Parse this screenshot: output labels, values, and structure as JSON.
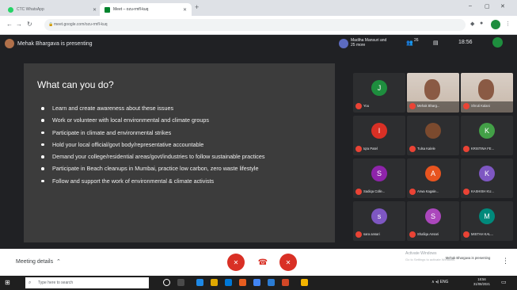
{
  "browser": {
    "tabs": [
      {
        "title": "CTC WhatsApp"
      },
      {
        "title": "Meet – ozu-rmfl-kuq"
      }
    ],
    "new_tab": "+",
    "win_min": "–",
    "win_max": "▢",
    "win_close": "✕",
    "url": "meet.google.com/ozu-rmfl-kuq"
  },
  "meet": {
    "presenter_label": "Mehak Bhargava is presenting",
    "slide": {
      "title": "What can you do?",
      "bullets": [
        "Learn and create awareness about these issues",
        "Work or volunteer with local environmental and climate groups",
        "Participate in climate and environmental strikes",
        "Hold your local official/govt body/representative accountable",
        "Demand your college/residential areas/govt/industries to follow sustainable practices",
        "Participate in Beach cleanups in Mumbai, practice low carbon, zero waste lifestyle",
        "Follow and support the work of environmental & climate activists"
      ]
    },
    "header": {
      "participants": "Madiha Mansuri and 25 more",
      "participant_count": "26",
      "time": "18:56"
    },
    "tiles": [
      {
        "name": "You",
        "initial": "J",
        "color": "#1e8e3e",
        "video": false
      },
      {
        "name": "Mehak Bharg...",
        "initial": "",
        "color": "",
        "video": true
      },
      {
        "name": "Shruti Kalani",
        "initial": "",
        "color": "",
        "video": true
      },
      {
        "name": "Iqra Patel",
        "initial": "I",
        "color": "#d93025",
        "video": false
      },
      {
        "name": "Tulsa Kalele",
        "initial": "",
        "color": "#7b4a2e",
        "video": false
      },
      {
        "name": "KRISTINA FE...",
        "initial": "K",
        "color": "#43a047",
        "video": false
      },
      {
        "name": "Sadiqa Colle...",
        "initial": "S",
        "color": "#8e24aa",
        "video": false
      },
      {
        "name": "Arwa Kagale...",
        "initial": "A",
        "color": "#e8541f",
        "video": false
      },
      {
        "name": "KASHISH KU...",
        "initial": "K",
        "color": "#7e57c2",
        "video": false
      },
      {
        "name": "sara ansari",
        "initial": "s",
        "color": "#7e57c2",
        "video": false
      },
      {
        "name": "Shafiqa Ansari",
        "initial": "S",
        "color": "#ab47bc",
        "video": false
      },
      {
        "name": "MISTAH KAL...",
        "initial": "M",
        "color": "#00897b",
        "video": false
      }
    ]
  },
  "controls": {
    "meeting_details": "Meeting details",
    "activate_windows": "Activate Windows",
    "activate_windows_sub": "Go to Settings to activate Windows.",
    "presenting_btn": "Mehak Bhargava is presenting"
  },
  "taskbar": {
    "search_placeholder": "Type here to search",
    "tray": "∧ ◂) ENG",
    "time": "18:56",
    "date": "31/08/2021"
  },
  "colors": {
    "danger": "#d93025",
    "meet_bg": "#202124",
    "slide_bg": "#3c3c3c"
  }
}
